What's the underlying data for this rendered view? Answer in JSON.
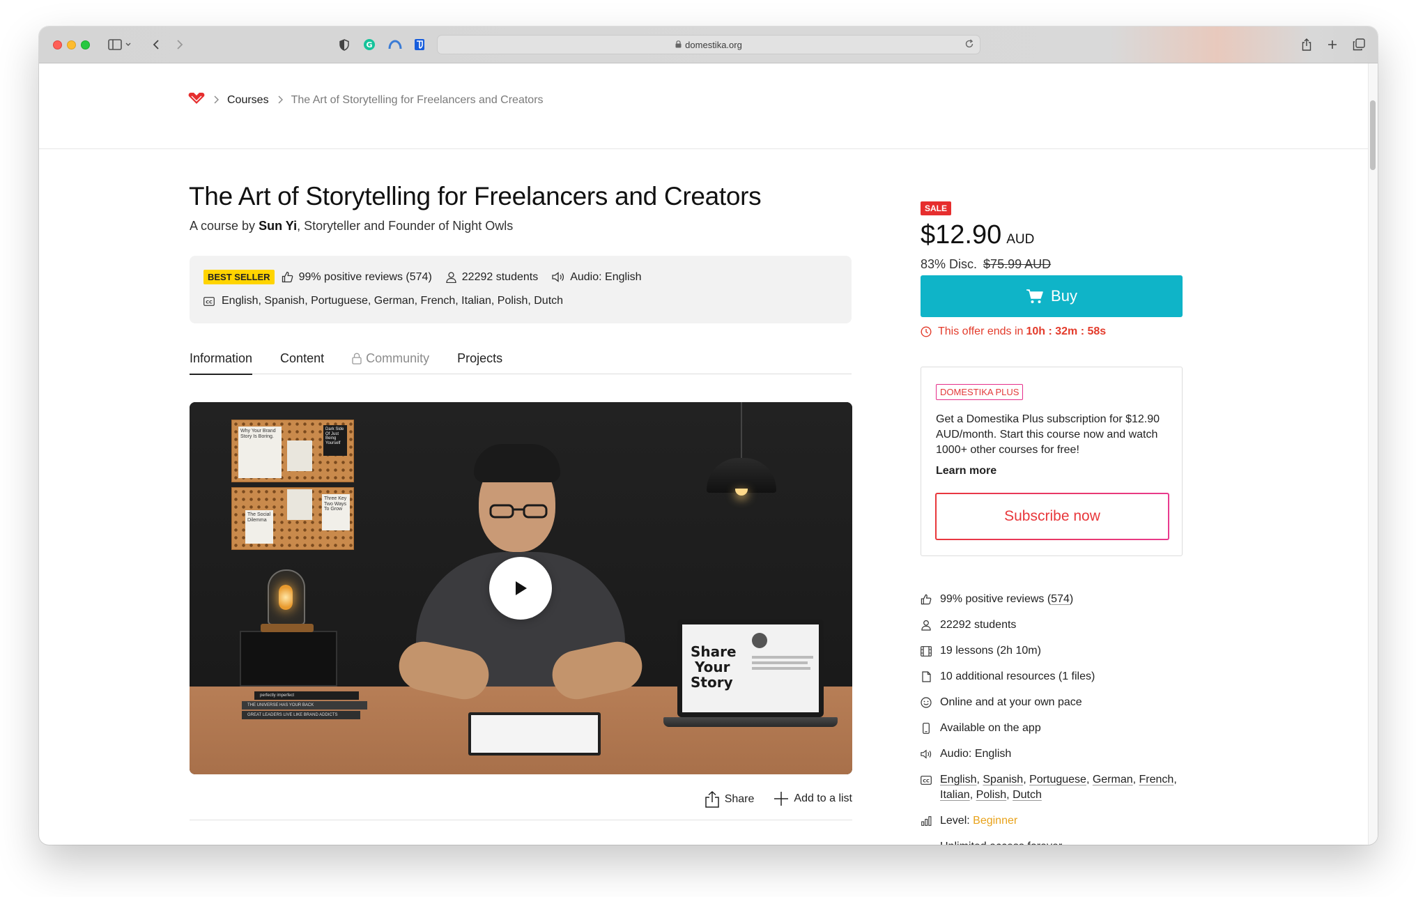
{
  "browser": {
    "url": "domestika.org"
  },
  "breadcrumb": {
    "courses": "Courses",
    "current": "The Art of Storytelling for Freelancers and Creators"
  },
  "course": {
    "title": "The Art of Storytelling for Freelancers and Creators",
    "byline_prefix": "A course by",
    "author": "Sun Yi",
    "byline_suffix": ", Storyteller and Founder of Night Owls"
  },
  "stats": {
    "badge": "BEST SELLER",
    "reviews": "99% positive reviews (574)",
    "students": "22292 students",
    "audio": "Audio: English",
    "subtitles": "English, Spanish, Portuguese, German, French, Italian, Polish, Dutch"
  },
  "tabs": [
    {
      "label": "Information"
    },
    {
      "label": "Content"
    },
    {
      "label": "Community"
    },
    {
      "label": "Projects"
    }
  ],
  "video": {
    "laptop_line1": "Share",
    "laptop_line2": "Your",
    "laptop_line3": "Story",
    "card1": "Why Your Brand Story Is Boring.",
    "card2": "Dark Side Of Just Being Yourself",
    "card3": "Three Key Two Ways To Grow",
    "card4": "The Social Dilemma",
    "book1": "perfectly imperfect",
    "book2": "THE UNIVERSE HAS YOUR BACK",
    "book3": "GREAT LEADERS LIVE LIKE BRAND ADDICTS"
  },
  "actions": {
    "share": "Share",
    "add_to_list": "Add to a list"
  },
  "pricing": {
    "sale_badge": "SALE",
    "price": "$12.90",
    "currency": "AUD",
    "discount": "83% Disc.",
    "original": "$75.99 AUD",
    "buy": "Buy",
    "offer_prefix": "This offer ends in",
    "offer_time": "10h : 32m : 58s"
  },
  "plus": {
    "badge": "DOMESTIKA PLUS",
    "text": "Get a Domestika Plus subscription for $12.90 AUD/month. Start this course now and watch 1000+ other courses for free!",
    "learn_more": "Learn more",
    "subscribe": "Subscribe now"
  },
  "features": {
    "reviews_prefix": "99% positive reviews (",
    "reviews_count": "574",
    "reviews_suffix": ")",
    "students": "22292 students",
    "lessons": "19 lessons (2h 10m)",
    "resources": "10 additional resources (1 files)",
    "pace": "Online and at your own pace",
    "app": "Available on the app",
    "audio": "Audio: English",
    "subtitles": [
      "English",
      "Spanish",
      "Portuguese",
      "German",
      "French",
      "Italian",
      "Polish",
      "Dutch"
    ],
    "level_label": "Level:",
    "level_value": "Beginner",
    "access": "Unlimited access forever"
  },
  "colors": {
    "brand_red": "#e62e2e",
    "buy_teal": "#0fb4c8",
    "best_seller_yellow": "#ffd400",
    "level_orange": "#e8a21a"
  }
}
